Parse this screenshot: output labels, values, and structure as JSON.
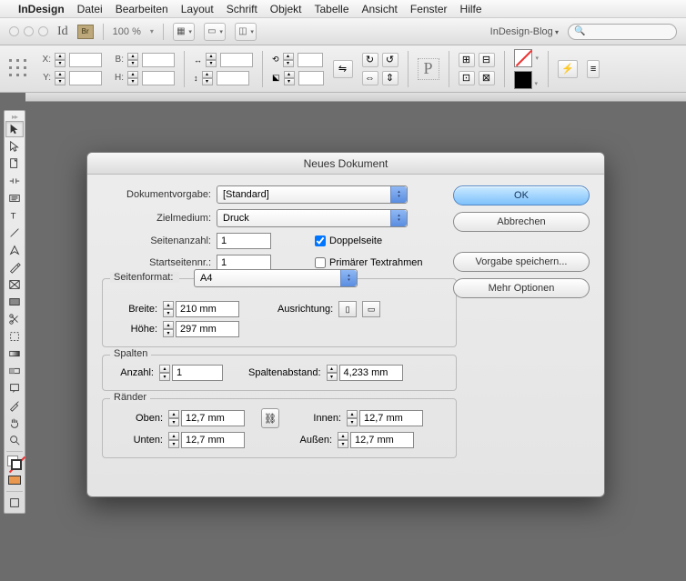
{
  "menubar": {
    "apple": "",
    "items": [
      "InDesign",
      "Datei",
      "Bearbeiten",
      "Layout",
      "Schrift",
      "Objekt",
      "Tabelle",
      "Ansicht",
      "Fenster",
      "Hilfe"
    ]
  },
  "toolbar": {
    "br": "Br",
    "zoom": "100 %",
    "workspace": "InDesign-Blog"
  },
  "controlbar": {
    "x": "X:",
    "y": "Y:",
    "b": "B:",
    "h": "H:"
  },
  "dialog": {
    "title": "Neues Dokument",
    "preset_label": "Dokumentvorgabe:",
    "preset_value": "[Standard]",
    "intent_label": "Zielmedium:",
    "intent_value": "Druck",
    "pages_label": "Seitenanzahl:",
    "pages_value": "1",
    "facing_label": "Doppelseite",
    "startpage_label": "Startseitennr.:",
    "startpage_value": "1",
    "masterframe_label": "Primärer Textrahmen",
    "pagesize": {
      "legend": "Seitenformat:",
      "value": "A4",
      "width_label": "Breite:",
      "width_value": "210 mm",
      "height_label": "Höhe:",
      "height_value": "297 mm",
      "orient_label": "Ausrichtung:"
    },
    "columns": {
      "legend": "Spalten",
      "count_label": "Anzahl:",
      "count_value": "1",
      "gutter_label": "Spaltenabstand:",
      "gutter_value": "4,233 mm"
    },
    "margins": {
      "legend": "Ränder",
      "top_label": "Oben:",
      "top_value": "12,7 mm",
      "bottom_label": "Unten:",
      "bottom_value": "12,7 mm",
      "inside_label": "Innen:",
      "inside_value": "12,7 mm",
      "outside_label": "Außen:",
      "outside_value": "12,7 mm"
    },
    "buttons": {
      "ok": "OK",
      "cancel": "Abbrechen",
      "save": "Vorgabe speichern...",
      "more": "Mehr Optionen"
    }
  }
}
